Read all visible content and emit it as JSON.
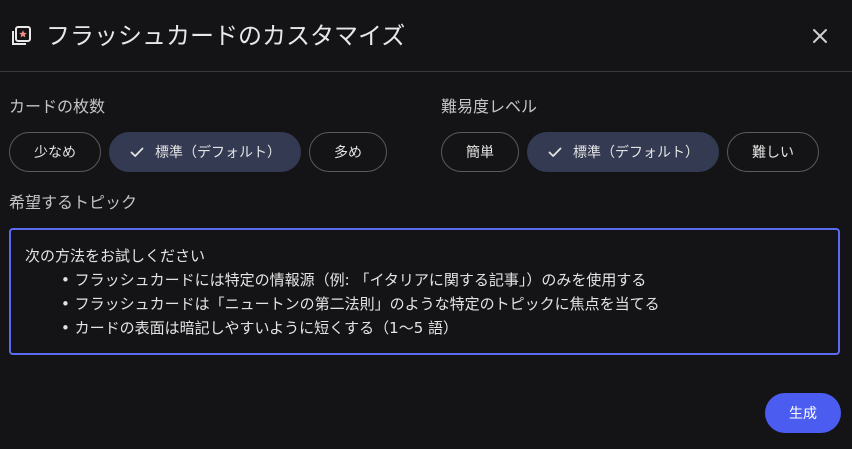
{
  "header": {
    "title": "フラッシュカードのカスタマイズ"
  },
  "card_count": {
    "label": "カードの枚数",
    "options": [
      {
        "label": "少なめ",
        "selected": false
      },
      {
        "label": "標準（デフォルト）",
        "selected": true
      },
      {
        "label": "多め",
        "selected": false
      }
    ]
  },
  "difficulty": {
    "label": "難易度レベル",
    "options": [
      {
        "label": "簡単",
        "selected": false
      },
      {
        "label": "標準（デフォルト）",
        "selected": true
      },
      {
        "label": "難しい",
        "selected": false
      }
    ]
  },
  "topic": {
    "label": "希望するトピック",
    "placeholder_heading": "次の方法をお試しください",
    "placeholder_items": [
      "• フラッシュカードには特定の情報源（例: 「イタリアに関する記事」）のみを使用する",
      "• フラッシュカードは「ニュートンの第二法則」のような特定のトピックに焦点を当てる",
      "• カードの表面は暗記しやすいように短くする（1〜5 語）"
    ]
  },
  "actions": {
    "generate_label": "生成"
  },
  "colors": {
    "background": "#141416",
    "accent": "#4b5cf0",
    "selected_chip": "#333a52",
    "focus_border": "#5b6cf0"
  }
}
